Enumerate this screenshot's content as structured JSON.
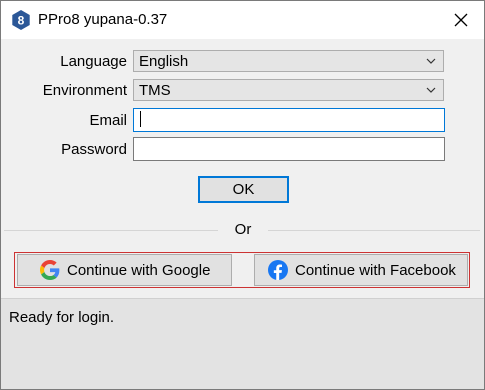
{
  "window": {
    "title": "PPro8 yupana-0.37",
    "app_icon_glyph": "8",
    "app_icon_color": "#2b5797",
    "close_icon": "close-icon"
  },
  "form": {
    "language": {
      "label": "Language",
      "value": "English"
    },
    "environment": {
      "label": "Environment",
      "value": "TMS"
    },
    "email": {
      "label": "Email",
      "value": "",
      "focused": true
    },
    "password": {
      "label": "Password",
      "value": ""
    },
    "ok_label": "OK"
  },
  "separator_text": "Or",
  "social": {
    "google": {
      "label": "Continue with Google",
      "icon": "google-icon"
    },
    "facebook": {
      "label": "Continue with Facebook",
      "icon": "facebook-icon",
      "color": "#1877f2"
    },
    "highlight_border_color": "#cc3333"
  },
  "status": {
    "text": "Ready for login."
  },
  "colors": {
    "focus_accent": "#0078d7",
    "window_bg": "#f0f0f0",
    "status_bg": "#e3e3e3"
  }
}
